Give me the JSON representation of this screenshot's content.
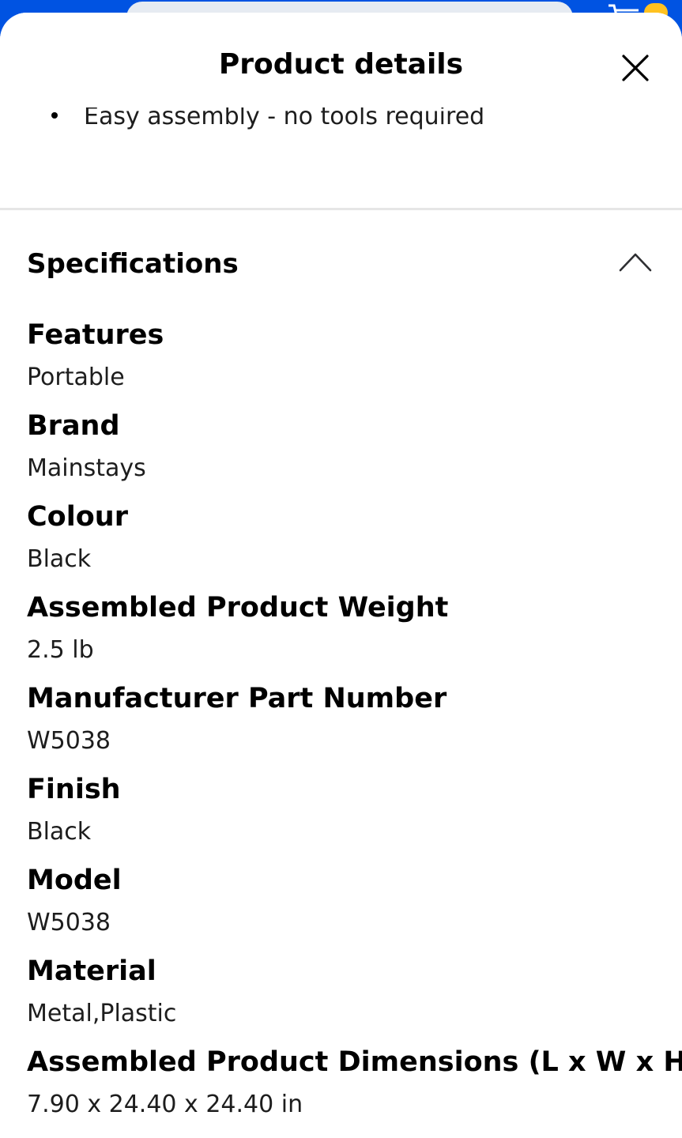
{
  "app": {
    "search_placeholder": "",
    "accent_color": "#0053e2",
    "badge_color": "#ffc220"
  },
  "sheet": {
    "title": "Product details",
    "close_icon": "close-icon"
  },
  "description": {
    "last_bullet": "Easy assembly - no tools required"
  },
  "specifications": {
    "title": "Specifications",
    "expanded": true,
    "toggle_icon": "chevron-up-icon",
    "items": [
      {
        "label": "Features",
        "value": "Portable"
      },
      {
        "label": "Brand",
        "value": "Mainstays"
      },
      {
        "label": "Colour",
        "value": "Black"
      },
      {
        "label": "Assembled Product Weight",
        "value": "2.5 lb"
      },
      {
        "label": "Manufacturer Part Number",
        "value": "W5038"
      },
      {
        "label": "Finish",
        "value": "Black"
      },
      {
        "label": "Model",
        "value": "W5038"
      },
      {
        "label": "Material",
        "value": "Metal,Plastic"
      },
      {
        "label": "Assembled Product Dimensions (L x W x H)",
        "value": "7.90 x 24.40 x 24.40 in"
      }
    ]
  }
}
